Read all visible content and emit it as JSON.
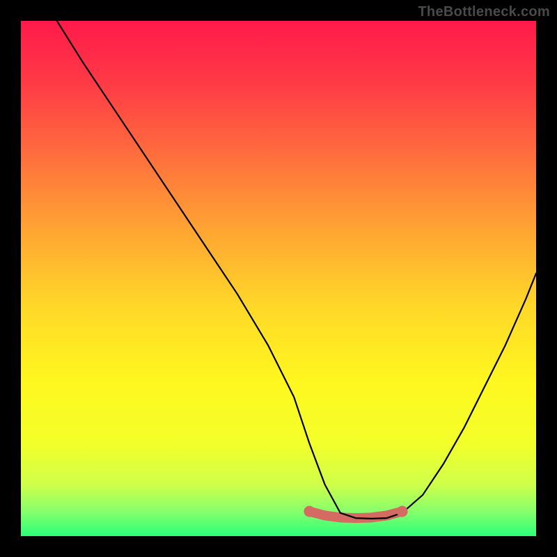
{
  "attribution": "TheBottleneck.com",
  "chart_data": {
    "type": "line",
    "title": "",
    "xlabel": "",
    "ylabel": "",
    "xlim": [
      0,
      100
    ],
    "ylim": [
      0,
      100
    ],
    "series": [
      {
        "name": "bottleneck-curve",
        "x": [
          7,
          12,
          18,
          24,
          30,
          36,
          42,
          48,
          53,
          56,
          59,
          62,
          65,
          68,
          71,
          74,
          78,
          82,
          86,
          90,
          94,
          98,
          100
        ],
        "y": [
          100,
          92,
          83,
          74,
          65,
          56,
          47,
          37,
          27,
          18,
          10,
          4.5,
          3.5,
          3.4,
          3.5,
          4.5,
          8,
          14,
          21,
          29,
          37,
          46,
          51
        ]
      },
      {
        "name": "optimal-zone-highlight",
        "x": [
          56,
          59,
          62,
          65,
          68,
          71,
          74
        ],
        "y": [
          4.8,
          4.0,
          3.6,
          3.5,
          3.6,
          4.0,
          4.8
        ]
      }
    ],
    "gradient_stops": [
      {
        "pos": 0.0,
        "color": "#ff1a4a"
      },
      {
        "pos": 0.12,
        "color": "#ff3a46"
      },
      {
        "pos": 0.25,
        "color": "#ff6a3e"
      },
      {
        "pos": 0.4,
        "color": "#ffa233"
      },
      {
        "pos": 0.55,
        "color": "#ffd728"
      },
      {
        "pos": 0.7,
        "color": "#fff71f"
      },
      {
        "pos": 0.82,
        "color": "#f3ff2a"
      },
      {
        "pos": 0.9,
        "color": "#cfff4a"
      },
      {
        "pos": 0.95,
        "color": "#8aff6a"
      },
      {
        "pos": 1.0,
        "color": "#2cff7a"
      }
    ],
    "highlight_color": "#d46a62",
    "curve_color": "#000000"
  }
}
